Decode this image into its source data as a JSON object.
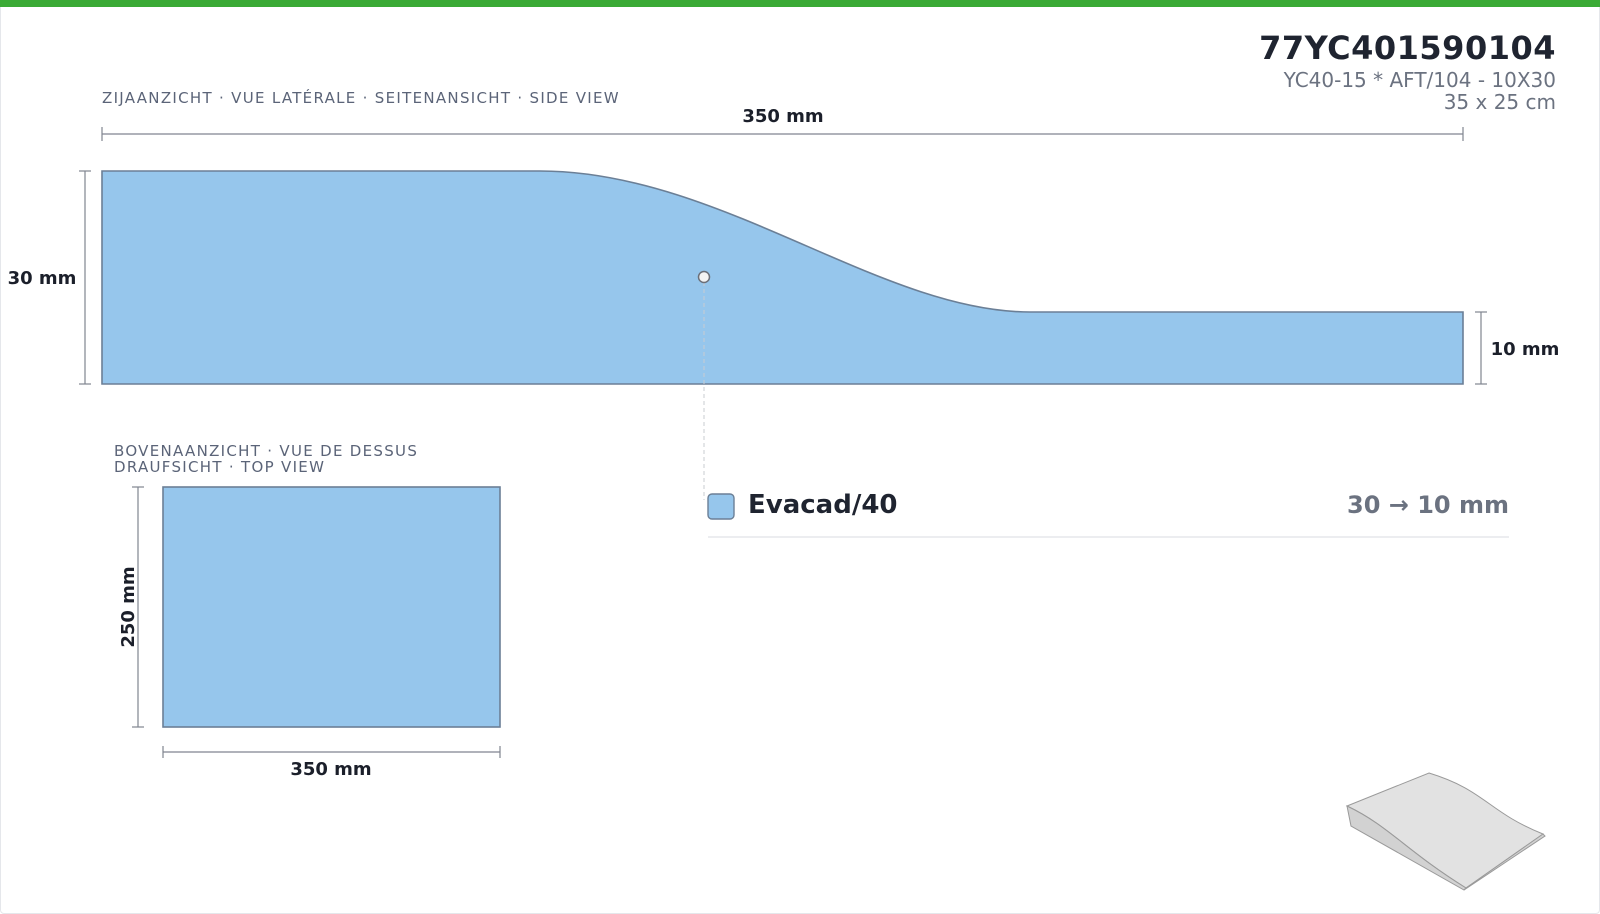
{
  "header": {
    "code": "77YC401590104",
    "description": "YC40-15 * AFT/104 - 10X30",
    "size": "35 x 25 cm"
  },
  "side_view": {
    "caption": "ZIJAANZICHT · VUE LATÉRALE · SEITENANSICHT · SIDE VIEW",
    "length_label": "350 mm",
    "left_height_label": "30 mm",
    "right_height_label": "10 mm"
  },
  "top_view": {
    "caption_line1": "BOVENAANZICHT · VUE DE DESSUS",
    "caption_line2": "DRAUFSICHT · TOP VIEW",
    "height_label": "250 mm",
    "width_label": "350 mm"
  },
  "legend": {
    "material": "Evacad/40",
    "range": "30 → 10 mm"
  },
  "colors": {
    "accent_bar": "#3aaa35",
    "material_fill": "#96c6ec",
    "outline": "#6b7f96",
    "dimension_line": "#808590",
    "thumbnail_fill": "#e2e2e2"
  }
}
